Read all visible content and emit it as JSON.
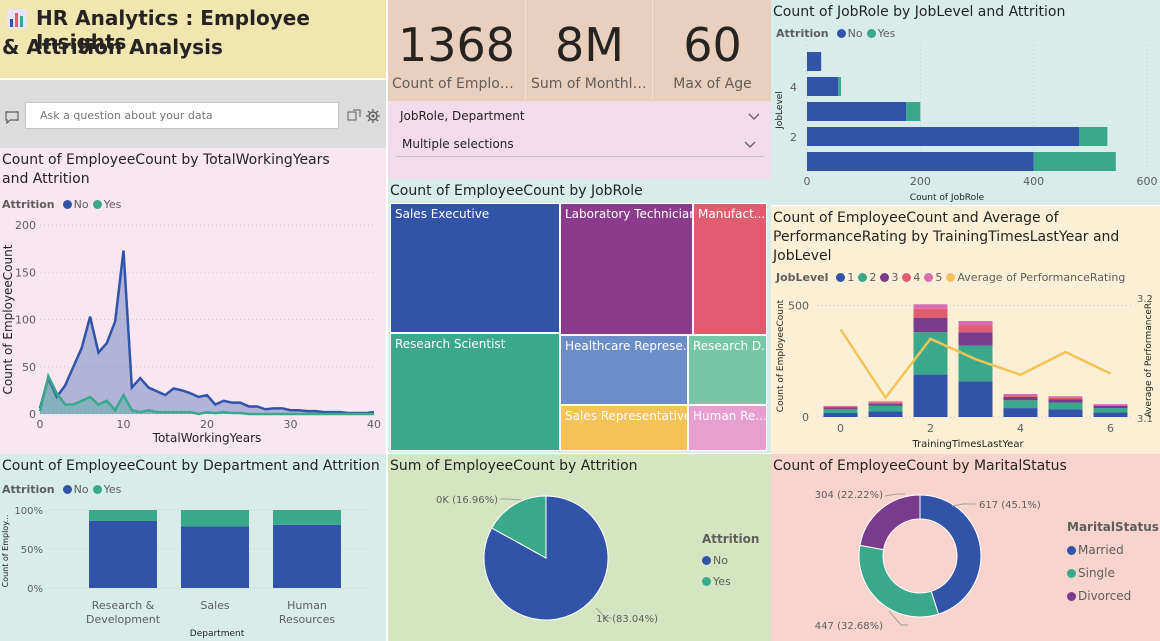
{
  "header": {
    "title_line1": "HR Analytics : Employee Insights",
    "title_line2": "& Attrition Analysis",
    "icon": "bar-chart-icon"
  },
  "qa": {
    "placeholder": "Ask a question about your data"
  },
  "kpis": [
    {
      "value": "1368",
      "label": "Count of Employe..."
    },
    {
      "value": "8M",
      "label": "Sum of Monthly..."
    },
    {
      "value": "60",
      "label": "Max of Age"
    }
  ],
  "slicer": {
    "title": "JobRole, Department",
    "selected": "Multiple selections"
  },
  "colors": {
    "blue": "#3154a8",
    "teal": "#3aa88b",
    "purple": "#7b3b8c",
    "red": "#e05d6f",
    "pink": "#d86db0",
    "yellow": "#f5c35a"
  },
  "chart_data": [
    {
      "type": "area",
      "title": "Count of EmployeeCount by TotalWorkingYears and Attrition",
      "xlabel": "TotalWorkingYears",
      "ylabel": "Count of EmployeeCount",
      "xlim": [
        0,
        40
      ],
      "ylim": [
        0,
        200
      ],
      "xticks": [
        0,
        10,
        20,
        30,
        40
      ],
      "yticks": [
        0,
        50,
        100,
        150,
        200
      ],
      "legend_title": "Attrition",
      "x": [
        0,
        1,
        2,
        3,
        4,
        5,
        6,
        7,
        8,
        9,
        10,
        11,
        12,
        13,
        14,
        15,
        16,
        17,
        18,
        19,
        20,
        21,
        22,
        23,
        24,
        25,
        26,
        27,
        28,
        29,
        30,
        31,
        32,
        33,
        34,
        35,
        36,
        37,
        38,
        39,
        40
      ],
      "series": [
        {
          "name": "No",
          "values": [
            6,
            38,
            18,
            30,
            50,
            70,
            103,
            65,
            75,
            98,
            173,
            28,
            38,
            28,
            24,
            20,
            27,
            25,
            22,
            18,
            20,
            10,
            14,
            12,
            12,
            8,
            8,
            5,
            6,
            6,
            4,
            4,
            3,
            3,
            2,
            2,
            2,
            1,
            1,
            1,
            2
          ]
        },
        {
          "name": "Yes",
          "values": [
            3,
            40,
            22,
            10,
            10,
            14,
            18,
            10,
            14,
            4,
            20,
            4,
            2,
            4,
            2,
            2,
            2,
            2,
            2,
            0,
            2,
            1,
            2,
            1,
            1,
            0,
            0,
            0,
            0,
            0,
            0,
            0,
            0,
            0,
            0,
            0,
            0,
            0,
            0,
            0,
            0
          ]
        }
      ]
    },
    {
      "type": "bar",
      "orientation": "horizontal",
      "stacked": true,
      "title": "Count of JobRole by JobLevel and Attrition",
      "xlabel": "Count of JobRole",
      "ylabel": "JobLevel",
      "xlim": [
        0,
        600
      ],
      "xticks": [
        0,
        200,
        400,
        600
      ],
      "ytick_labels": [
        "2",
        "4"
      ],
      "legend_title": "Attrition",
      "categories": [
        "5",
        "4",
        "3",
        "2",
        "1"
      ],
      "series": [
        {
          "name": "No",
          "values": [
            25,
            55,
            175,
            480,
            400
          ]
        },
        {
          "name": "Yes",
          "values": [
            0,
            5,
            25,
            50,
            145
          ]
        }
      ]
    },
    {
      "type": "heatmap",
      "chart_kind": "treemap",
      "title": "Count of EmployeeCount by JobRole",
      "labels": [
        "Sales Executive",
        "Laboratory Technician",
        "Manufact...",
        "Research Scientist",
        "Healthcare Represe...",
        "Research D...",
        "Sales Representative",
        "Human Re..."
      ]
    },
    {
      "type": "bar",
      "stacked": true,
      "combo_line": true,
      "title": "Count of EmployeeCount and Average of PerformanceRating by TrainingTimesLastYear and JobLevel",
      "xlabel": "TrainingTimesLastYear",
      "ylabel": "Count of EmployeeCount",
      "y2label": "Average of PerformanceR...",
      "xlim": [
        -0.5,
        6.5
      ],
      "ylim": [
        0,
        560
      ],
      "y2lim": [
        3.1,
        3.2
      ],
      "xticks": [
        0,
        2,
        4,
        6
      ],
      "yticks": [
        0,
        500
      ],
      "y2ticks": [
        3.1,
        3.2
      ],
      "legend_title": "JobLevel",
      "categories": [
        0,
        1,
        2,
        3,
        4,
        5,
        6
      ],
      "series": [
        {
          "name": "1",
          "values": [
            18,
            25,
            190,
            160,
            40,
            35,
            20
          ]
        },
        {
          "name": "2",
          "values": [
            18,
            25,
            190,
            160,
            35,
            30,
            20
          ]
        },
        {
          "name": "3",
          "values": [
            8,
            10,
            65,
            60,
            15,
            15,
            10
          ]
        },
        {
          "name": "4",
          "values": [
            4,
            6,
            40,
            30,
            8,
            8,
            5
          ]
        },
        {
          "name": "5",
          "values": [
            2,
            4,
            20,
            20,
            5,
            5,
            3
          ]
        }
      ],
      "line": {
        "name": "Average of PerformanceRating",
        "values": [
          3.174,
          3.117,
          3.166,
          3.149,
          3.136,
          3.155,
          3.137
        ]
      }
    },
    {
      "type": "bar",
      "stacked": true,
      "percent": true,
      "title": "Count of EmployeeCount by Department and Attrition",
      "xlabel": "Department",
      "ylabel": "Count of Employ...",
      "yticks": [
        "0%",
        "50%",
        "100%"
      ],
      "legend_title": "Attrition",
      "categories": [
        "Research & Development",
        "Sales",
        "Human Resources"
      ],
      "series": [
        {
          "name": "No",
          "values": [
            86,
            79,
            81
          ]
        },
        {
          "name": "Yes",
          "values": [
            14,
            21,
            19
          ]
        }
      ]
    },
    {
      "type": "pie",
      "title": "Sum of EmployeeCount by Attrition",
      "legend_title": "Attrition",
      "slices": [
        {
          "name": "No",
          "value": 83.04,
          "label": "1K (83.04%)"
        },
        {
          "name": "Yes",
          "value": 16.96,
          "label": "0K (16.96%)"
        }
      ]
    },
    {
      "type": "pie",
      "donut": true,
      "title": "Count of EmployeeCount by MaritalStatus",
      "legend_title": "MaritalStatus",
      "slices": [
        {
          "name": "Married",
          "value": 617,
          "label": "617 (45.1%)"
        },
        {
          "name": "Single",
          "value": 447,
          "label": "447 (32.68%)"
        },
        {
          "name": "Divorced",
          "value": 304,
          "label": "304 (22.22%)"
        }
      ]
    }
  ]
}
